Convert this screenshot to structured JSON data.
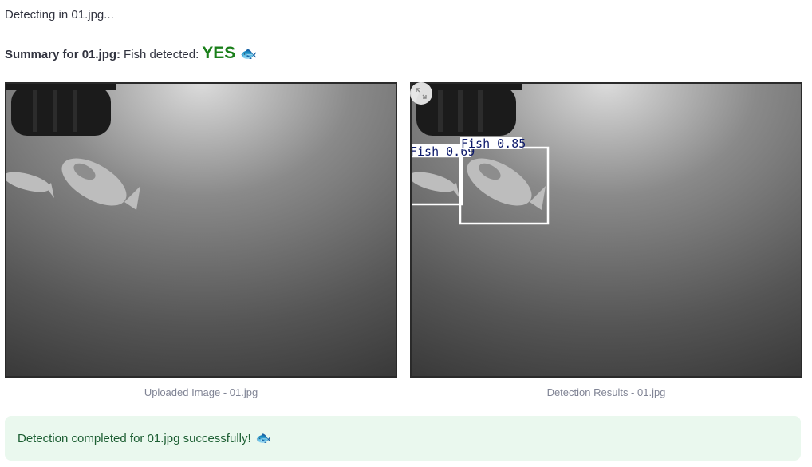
{
  "status": {
    "detecting_text": "Detecting in 01.jpg..."
  },
  "summary": {
    "prefix": "Summary for 01.jpg:",
    "label": "Fish detected:",
    "result": "YES",
    "emoji": "🐟"
  },
  "left_panel": {
    "caption": "Uploaded Image - 01.jpg"
  },
  "right_panel": {
    "caption": "Detection Results - 01.jpg",
    "expand_icon": "expand-icon",
    "detections": [
      {
        "label": "Fish 0.69"
      },
      {
        "label": "Fish 0.85"
      }
    ]
  },
  "success": {
    "message": "Detection completed for 01.jpg successfully!",
    "emoji": "🐟",
    "background": "#eaf8ee",
    "text_color": "#1d5f33"
  },
  "colors": {
    "yes": "#1a7f1a",
    "box_stroke": "#ffffff",
    "label_text": "#0d1a6b"
  }
}
